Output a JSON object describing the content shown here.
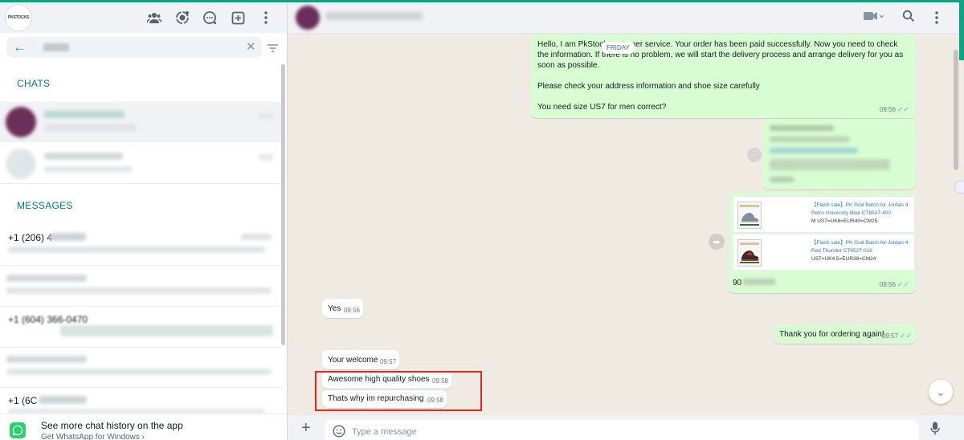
{
  "sidebar": {
    "logo_text": "PKSTOCKS",
    "search": {
      "value": ""
    },
    "chats_label": "CHATS",
    "messages_label": "MESSAGES",
    "message_rows": [
      {
        "name": "+1 (206) 4"
      },
      {
        "name": ""
      },
      {
        "name": "+1 (604) 366-0470"
      },
      {
        "name": ""
      },
      {
        "name": "+1 (6C"
      }
    ],
    "promo": {
      "title": "See more chat history on the app",
      "link": "Get WhatsApp for Windows"
    }
  },
  "chat": {
    "date_chip": "FRIDAY",
    "messages": [
      {
        "dir": "out",
        "text": "Hello, I am PkStock customer service. Your order has been paid successfully. Now you need to check the information. If there is no problem, we will start the delivery process and arrange delivery for you as soon as possible.",
        "text2": "Please check your address information and shoe size carefully",
        "text3": "You need size US7  for men correct?",
        "time": "09:56"
      },
      {
        "dir": "out",
        "type": "blurred",
        "time": ""
      },
      {
        "dir": "out",
        "type": "products",
        "time": "09:56",
        "caption": "90"
      },
      {
        "dir": "in",
        "text": "Yes",
        "time": "09:56"
      },
      {
        "dir": "out",
        "text": "Thank you for ordering again!",
        "time": "09:57"
      },
      {
        "dir": "in",
        "text": "Your welcome",
        "time": "09:57"
      },
      {
        "dir": "in",
        "text": "Awesome high quality shoes",
        "time": "09:58"
      },
      {
        "dir": "in",
        "text": "Thats why im repurchasing",
        "time": "09:58"
      }
    ],
    "products": [
      {
        "title": "【Flash sale】PK God Batch Air Jordan 4 Retro University Blue CT8527-400",
        "size": "M US7=UK6=EUR40=CM25"
      },
      {
        "title": "【Flash sale】PK God Batch Air Jordan 4 Red Thunder CT8527-016",
        "size": "US7=UK4.5=EUR38=CM24"
      }
    ],
    "composer_placeholder": "Type a message"
  },
  "colors": {
    "accent": "#00a884",
    "outgoing": "#d9fdd3",
    "incoming": "#ffffff",
    "wallpaper": "#efeae2",
    "ticks": "#53bdeb",
    "highlight": "#e2281e"
  },
  "icons": [
    "communities-icon",
    "status-icon",
    "channels-icon",
    "new-chat-icon",
    "menu-icon",
    "back-arrow-icon",
    "clear-icon",
    "filter-icon",
    "video-call-icon",
    "search-icon",
    "forward-icon",
    "scroll-down-icon",
    "plus-icon",
    "emoji-icon",
    "mic-icon",
    "whatsapp-logo-icon"
  ]
}
